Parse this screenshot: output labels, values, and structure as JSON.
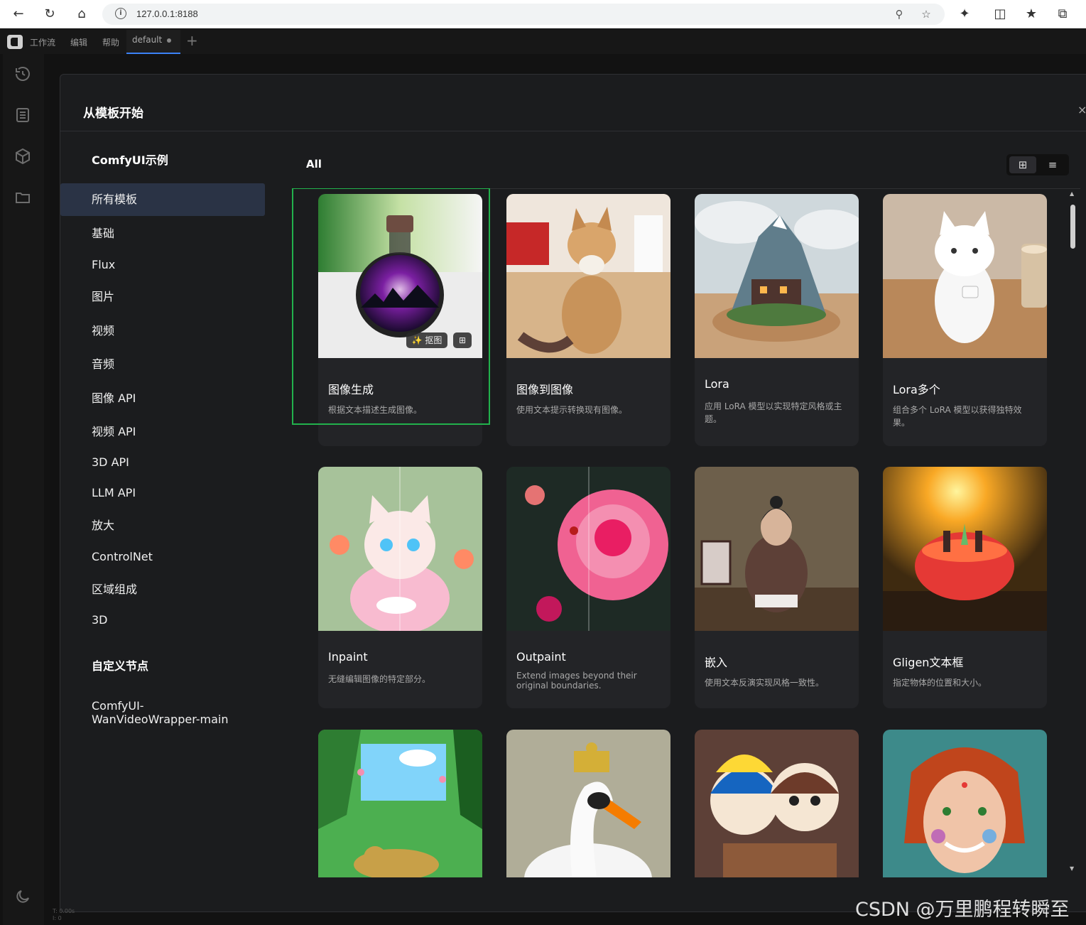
{
  "browser": {
    "url": "127.0.0.1:8188"
  },
  "app": {
    "menu": [
      "工作流",
      "编辑",
      "帮助"
    ],
    "workflow_tab": "default"
  },
  "modal": {
    "title": "从模板开始",
    "close": "×",
    "sidebar": {
      "section_examples": "ComfyUI示例",
      "items": [
        "所有模板",
        "基础",
        "Flux",
        "图片",
        "视频",
        "音频",
        "图像 API",
        "视频 API",
        "3D API",
        "LLM API",
        "放大",
        "ControlNet",
        "区域组成",
        "3D"
      ],
      "active_index": 0,
      "section_custom": "自定义节点",
      "custom_items": [
        "ComfyUI-\nWanVideoWrapper-main"
      ]
    },
    "main": {
      "heading": "All",
      "view_modes": [
        "grid",
        "list"
      ],
      "selected_view": "grid"
    },
    "cards": [
      {
        "title": "图像生成",
        "desc": "根据文本描述生成图像。",
        "badge_cutout": "抠图",
        "selected": true
      },
      {
        "title": "图像到图像",
        "desc": "使用文本提示转换现有图像。"
      },
      {
        "title": "Lora",
        "desc": "应用 LoRA 模型以实现特定风格或主题。"
      },
      {
        "title": "Lora多个",
        "desc": "组合多个 LoRA 模型以获得独特效果。"
      },
      {
        "title": "Inpaint",
        "desc": "无缝编辑图像的特定部分。"
      },
      {
        "title": "Outpaint",
        "desc": "Extend images beyond their original boundaries."
      },
      {
        "title": "嵌入",
        "desc": "使用文本反演实现风格一致性。"
      },
      {
        "title": "Gligen文本框",
        "desc": "指定物体的位置和大小。"
      },
      {
        "title": "",
        "desc": ""
      },
      {
        "title": "",
        "desc": ""
      },
      {
        "title": "",
        "desc": ""
      },
      {
        "title": "",
        "desc": ""
      }
    ]
  },
  "watermark": "CSDN @万里鹏程转瞬至",
  "stats": [
    "T: 0.00s",
    "I: 0"
  ]
}
